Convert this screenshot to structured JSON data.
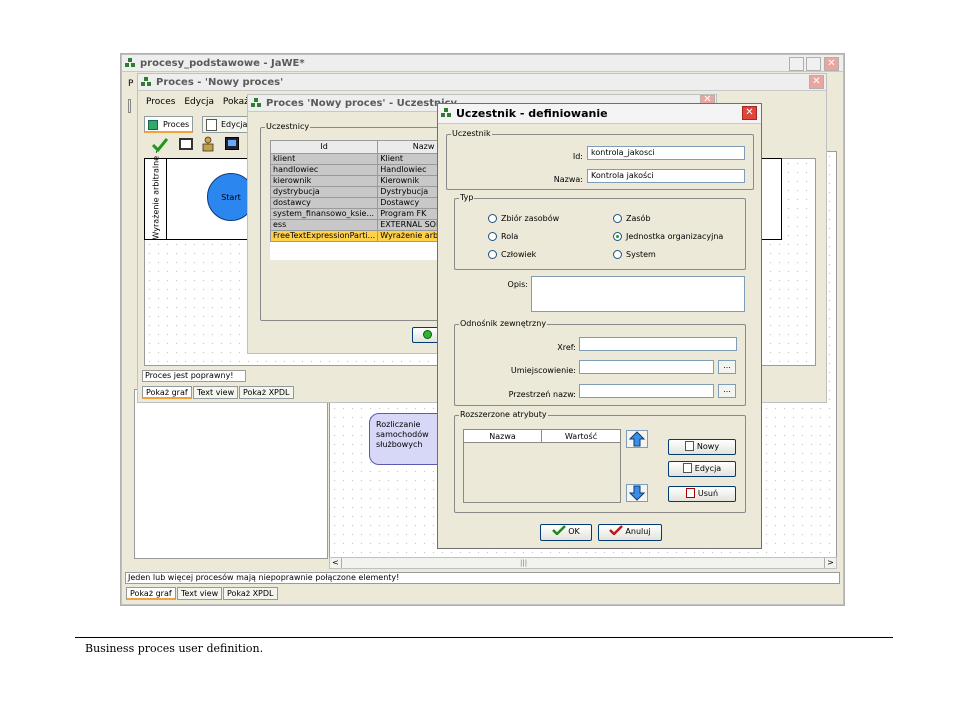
{
  "main_window": {
    "title": "procesy_podstawowe - JaWE*",
    "menu_first_letter": "P",
    "status_text": "Jeden lub więcej procesów mają niepoprawnie połączone elementy!",
    "tabs": [
      "Pokaż graf",
      "Text view",
      "Pokaż XPDL"
    ],
    "activity_label": "Rozliczanie samochodów służbowych",
    "undo_icon": "undo-arrow-icon",
    "scroll_left": "<",
    "scroll_right": ">",
    "scroll_grip": "|||"
  },
  "proces_window": {
    "title": "Proces - 'Nowy proces'",
    "menu": [
      "Proces",
      "Edycja",
      "Pokaż"
    ],
    "tabs_top": [
      "Proces",
      "Edycja"
    ],
    "lane_label": "Wyrażenie arbitralne -",
    "start_label": "Start",
    "status_text": "Proces jest poprawny!",
    "tabs_bottom": [
      "Pokaż graf",
      "Text view",
      "Pokaż XPDL"
    ]
  },
  "uczestnicy_window": {
    "title": "Proces 'Nowy proces' - Uczestnicy",
    "group_label": "Uczestnicy",
    "columns": [
      "Id",
      "Nazw"
    ],
    "rows": [
      {
        "id": "klient",
        "name": "Klient"
      },
      {
        "id": "handlowiec",
        "name": "Handlowiec"
      },
      {
        "id": "kierownik",
        "name": "Kierownik"
      },
      {
        "id": "dystrybucja",
        "name": "Dystrybucja"
      },
      {
        "id": "dostawcy",
        "name": "Dostawcy"
      },
      {
        "id": "system_finansowo_ksie...",
        "name": "Program FK"
      },
      {
        "id": "ess",
        "name": "EXTERNAL SOL"
      },
      {
        "id": "FreeTextExpressionParti...",
        "name": "Wyrażenie arbit"
      }
    ]
  },
  "dialog": {
    "title": "Uczestnik - definiowanie",
    "uczestnik_group": "Uczestnik",
    "id_label": "Id:",
    "id_value": "kontrola_jakosci",
    "nazwa_label": "Nazwa:",
    "nazwa_value": "Kontrola jakości",
    "typ_group": "Typ",
    "typ_options": [
      {
        "label": "Zbiór zasobów",
        "selected": false
      },
      {
        "label": "Zasób",
        "selected": false
      },
      {
        "label": "Rola",
        "selected": false
      },
      {
        "label": "Jednostka organizacyjna",
        "selected": true
      },
      {
        "label": "Człowiek",
        "selected": false
      },
      {
        "label": "System",
        "selected": false
      }
    ],
    "opis_label": "Opis:",
    "opis_value": "",
    "odnosnik_group": "Odnośnik zewnętrzny",
    "xref_label": "Xref:",
    "umiejscowienie_label": "Umiejscowienie:",
    "przestrzen_label": "Przestrzeń nazw:",
    "browse_label": "...",
    "rozszerzone_group": "Rozszerzone atrybuty",
    "attr_columns": [
      "Nazwa",
      "Wartość"
    ],
    "nowy_label": "Nowy",
    "edycja_label": "Edycja",
    "usun_label": "Usuń",
    "ok_label": "OK",
    "anuluj_label": "Anuluj"
  },
  "caption": "Business proces user definition."
}
